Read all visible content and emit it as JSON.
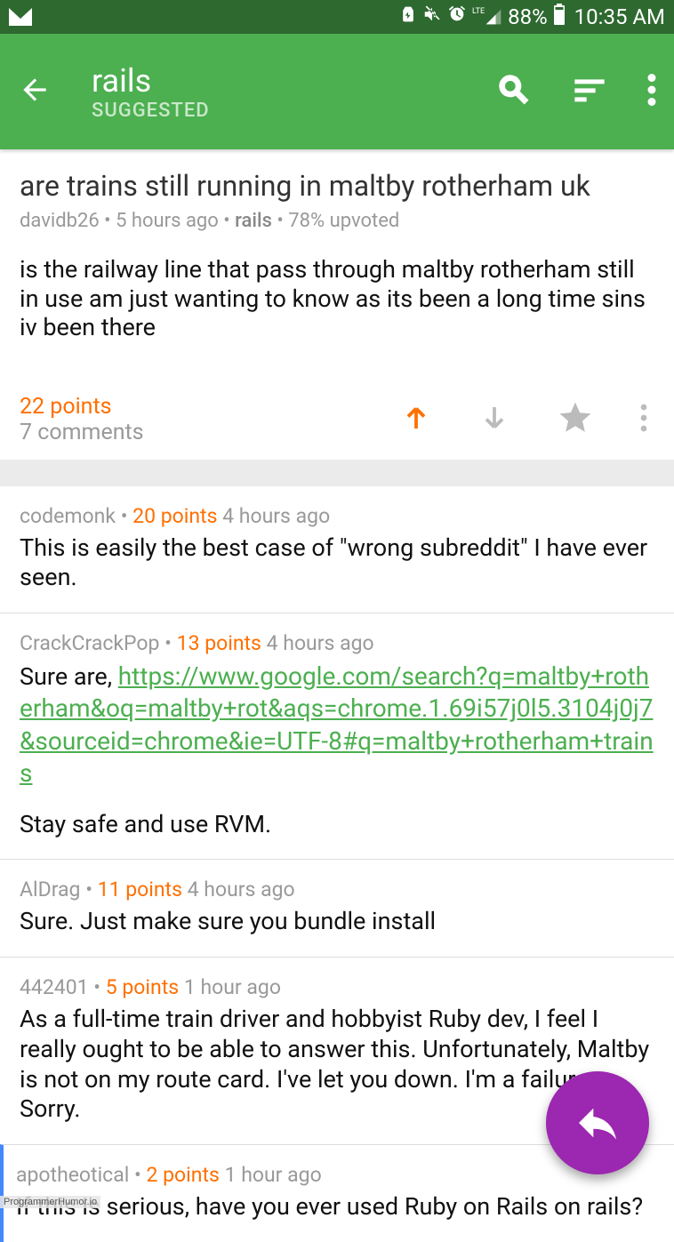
{
  "status_bar": {
    "battery_pct": "88%",
    "time": "10:35 AM",
    "network_badge": "LTE"
  },
  "app_bar": {
    "title": "rails",
    "subtitle": "SUGGESTED"
  },
  "post": {
    "title": "are trains still running in maltby rotherham uk",
    "author": "davidb26",
    "age": "5 hours ago",
    "sub": "rails",
    "upvote_pct": "78% upvoted",
    "body": "is the railway line that pass through maltby rotherham still in use am just wanting to know as its been a long time sins iv been there",
    "points": "22 points",
    "comments": "7 comments"
  },
  "comments": [
    {
      "user": "codemonk",
      "points": "20 points",
      "age": "4 hours ago",
      "body_pre": "This is easily the best case of \"wrong subreddit\" I have ever seen."
    },
    {
      "user": "CrackCrackPop",
      "points": "13 points",
      "age": "4 hours ago",
      "body_pre": "Sure are, ",
      "link": "https://www.google.com/search?q=maltby+rotherham&oq=maltby+rot&aqs=chrome.1.69i57j0l5.3104j0j7&sourceid=chrome&ie=UTF-8#q=maltby+rotherham+trains",
      "body_post": "Stay safe and use RVM."
    },
    {
      "user": "AlDrag",
      "points": "11 points",
      "age": "4 hours ago",
      "body_pre": "Sure. Just make sure you bundle install"
    },
    {
      "user": "442401",
      "points": "5 points",
      "age": "1 hour ago",
      "body_pre": "As a full-time train driver and hobbyist Ruby dev, I feel I really ought to be able to answer this. Unfortunately, Maltby is not on my route card. I've let you down. I'm a failure. Sorry."
    },
    {
      "user": "apotheotical",
      "points": "2 points",
      "age": "1 hour ago",
      "body_pre": "If this is serious, have you ever used Ruby on Rails on rails?"
    }
  ],
  "watermark": "ProgrammerHumor.io"
}
